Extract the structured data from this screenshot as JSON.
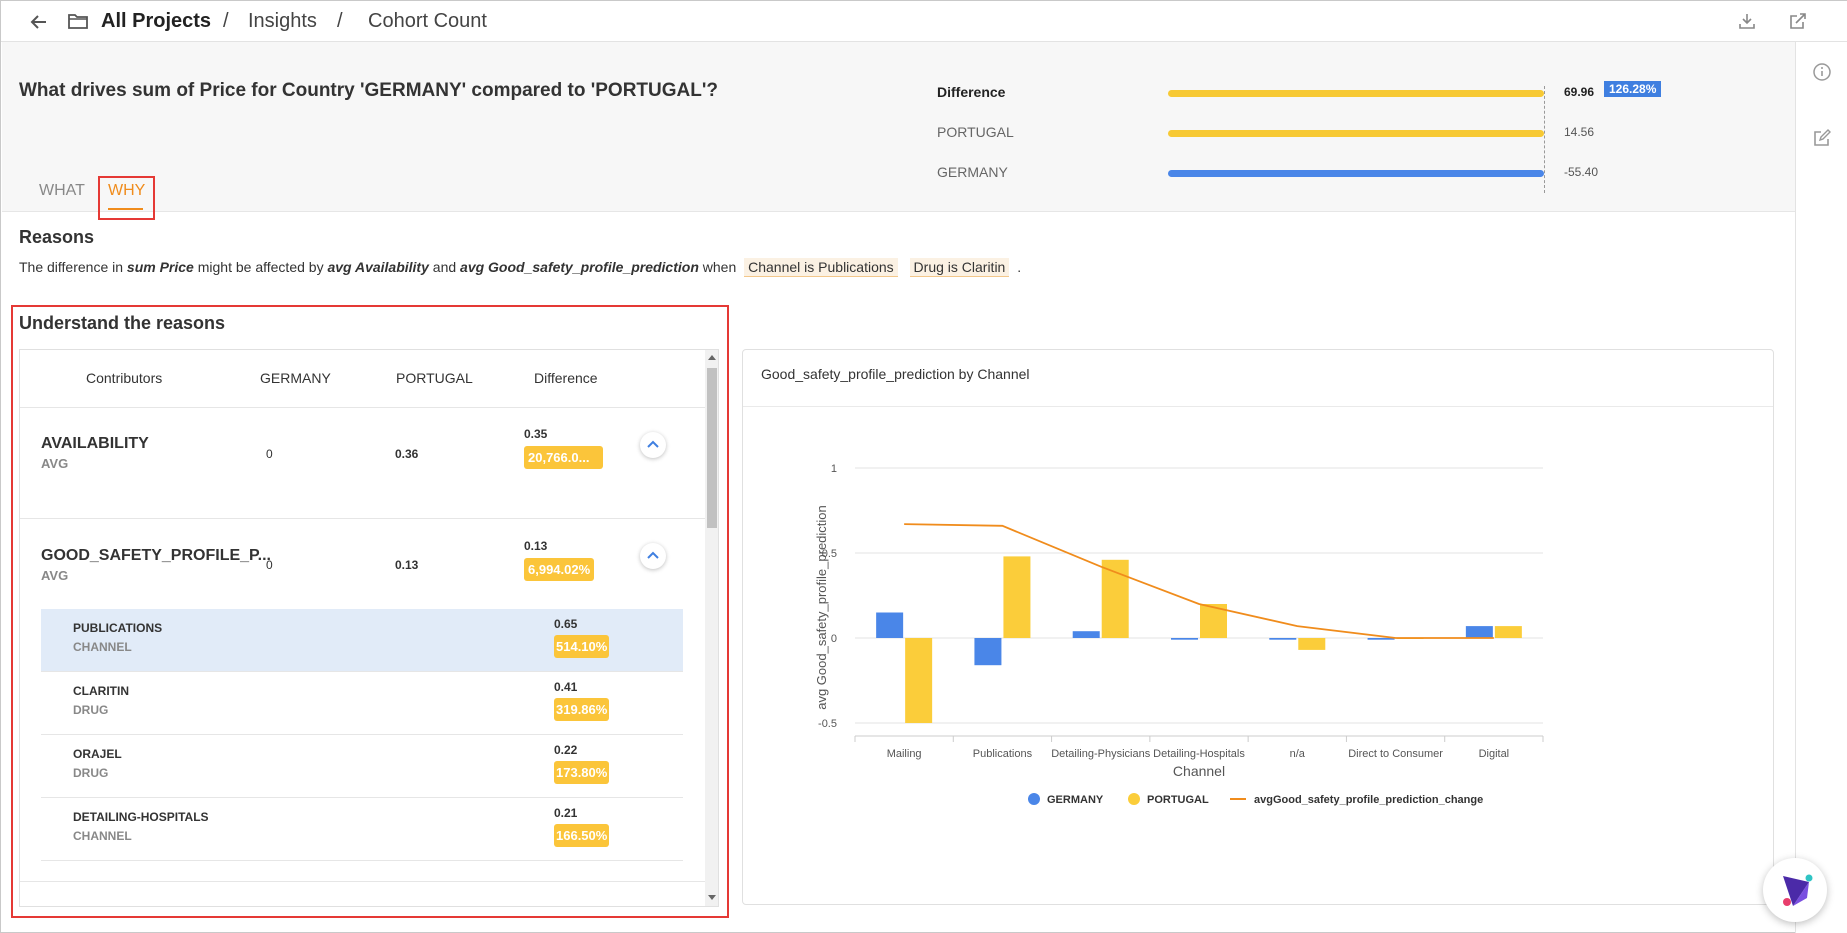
{
  "breadcrumb": {
    "root": "All Projects",
    "separator": "/",
    "level1": "Insights",
    "level2": "Cohort Count"
  },
  "question": "What drives sum of Price for Country 'GERMANY' compared to 'PORTUGAL'?",
  "tabs": [
    {
      "label": "WHAT",
      "active": false
    },
    {
      "label": "WHY",
      "active": true
    }
  ],
  "comparison": {
    "rows": [
      {
        "label": "Difference",
        "value": "69.96",
        "fraction": 1.0,
        "color": "#f7c934"
      },
      {
        "label": "PORTUGAL",
        "value": "14.56",
        "fraction": 1.0,
        "color": "#f7c934"
      },
      {
        "label": "GERMANY",
        "value": "-55.40",
        "fraction": 1.0,
        "color": "#4a86e8"
      }
    ],
    "difference_pct": "126.28%"
  },
  "reasons": {
    "title": "Reasons",
    "text_prefix": "The difference in",
    "metric": "sum Price",
    "text_mid1": "might be affected by",
    "factor1": "avg Availability",
    "text_and": "and",
    "factor2": "avg Good_safety_profile_prediction",
    "text_when": "when",
    "chip1": "Channel is Publications",
    "chip2": "Drug is Claritin",
    "text_end": "."
  },
  "understand_title": "Understand the reasons",
  "table": {
    "headers": [
      "Contributors",
      "GERMANY",
      "PORTUGAL",
      "Difference"
    ],
    "rows": [
      {
        "name": "AVAILABILITY",
        "agg": "AVG",
        "germany": "0",
        "portugal": "0.36",
        "diff": "0.35",
        "diff_pct": "20,766.0..."
      },
      {
        "name": "GOOD_SAFETY_PROFILE_P...",
        "agg": "AVG",
        "germany": "0",
        "portugal": "0.13",
        "diff": "0.13",
        "diff_pct": "6,994.02%"
      }
    ],
    "sub_rows": [
      {
        "name": "PUBLICATIONS",
        "type": "CHANNEL",
        "diff": "0.65",
        "diff_pct": "514.10%"
      },
      {
        "name": "CLARITIN",
        "type": "DRUG",
        "diff": "0.41",
        "diff_pct": "319.86%"
      },
      {
        "name": "ORAJEL",
        "type": "DRUG",
        "diff": "0.22",
        "diff_pct": "173.80%"
      },
      {
        "name": "DETAILING-HOSPITALS",
        "type": "CHANNEL",
        "diff": "0.21",
        "diff_pct": "166.50%"
      }
    ]
  },
  "colors": {
    "germany": "#4a86e8",
    "portugal": "#fbcd3a",
    "change_line": "#f08c1c",
    "accent": "#f08c1c",
    "highlight_box": "#e53935"
  },
  "icons": [
    "back-arrow-icon",
    "folder-icon",
    "download-icon",
    "share-icon",
    "info-icon",
    "edit-icon",
    "chevron-up-icon",
    "assistant-logo-icon"
  ],
  "chart_data": {
    "type": "bar",
    "title": "Good_safety_profile_prediction by Channel",
    "xlabel": "Channel",
    "ylabel": "avg Good_safety_profile_prediction",
    "ylim": [
      -0.5,
      1
    ],
    "yticks": [
      "1",
      "0.5",
      "0",
      "-0.5"
    ],
    "categories": [
      "Mailing",
      "Publications",
      "Detailing-Physicians",
      "Detailing-Hospitals",
      "n/a",
      "Direct to Consumer",
      "Digital"
    ],
    "series": [
      {
        "name": "GERMANY",
        "type": "bar",
        "values": [
          0.15,
          -0.16,
          0.04,
          -0.01,
          -0.01,
          -0.01,
          0.07
        ]
      },
      {
        "name": "PORTUGAL",
        "type": "bar",
        "values": [
          -0.5,
          0.48,
          0.46,
          0.2,
          -0.07,
          0.0,
          0.07
        ]
      },
      {
        "name": "avgGood_safety_profile_prediction_change",
        "type": "line",
        "values": [
          0.67,
          0.66,
          0.42,
          0.2,
          0.07,
          0.0,
          0.0
        ]
      }
    ],
    "grid": true,
    "legend": "bottom"
  },
  "legend_labels": [
    "GERMANY",
    "PORTUGAL",
    "avgGood_safety_profile_prediction_change"
  ]
}
